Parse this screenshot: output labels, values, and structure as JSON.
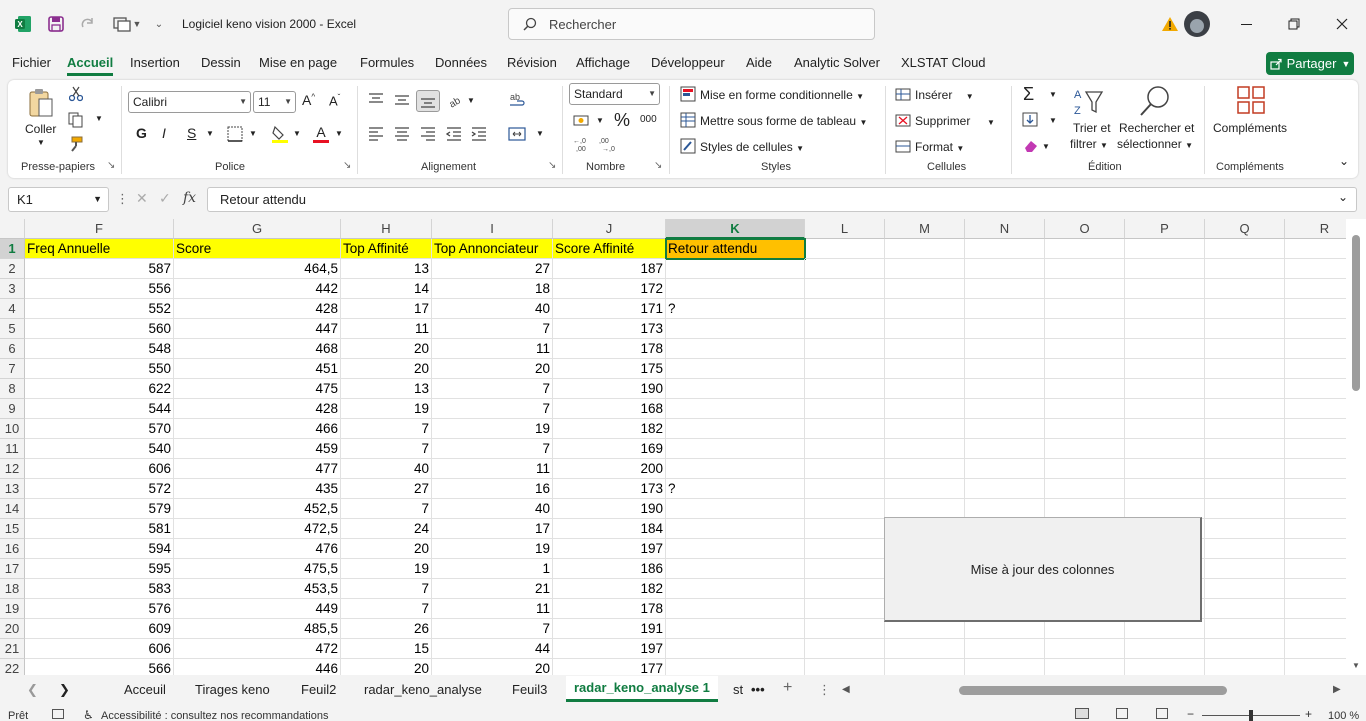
{
  "window": {
    "title": "Logiciel keno vision 2000  -  Excel",
    "search_placeholder": "Rechercher",
    "share_label": "Partager"
  },
  "menu": [
    "Fichier",
    "Accueil",
    "Insertion",
    "Dessin",
    "Mise en page",
    "Formules",
    "Données",
    "Révision",
    "Affichage",
    "Développeur",
    "Aide",
    "Analytic Solver",
    "XLSTAT Cloud"
  ],
  "ribbon": {
    "clipboard": {
      "paste": "Coller",
      "group": "Presse-papiers"
    },
    "font": {
      "name": "Calibri",
      "size": "11",
      "bold": "G",
      "italic": "I",
      "underline": "S",
      "group": "Police"
    },
    "alignment": {
      "group": "Alignement"
    },
    "number": {
      "format": "Standard",
      "group": "Nombre"
    },
    "styles": {
      "conditional": "Mise en forme conditionnelle",
      "table": "Mettre sous forme de tableau",
      "cell_styles": "Styles de cellules",
      "group": "Styles"
    },
    "cells": {
      "insert": "Insérer",
      "delete": "Supprimer",
      "format": "Format",
      "group": "Cellules"
    },
    "editing": {
      "sort1": "Trier et",
      "sort2": "filtrer",
      "find1": "Rechercher et",
      "find2": "sélectionner",
      "group": "Édition"
    },
    "addins": {
      "label": "Compléments",
      "group": "Compléments"
    }
  },
  "formula_bar": {
    "cell_ref": "K1",
    "fx": "fx",
    "content": "Retour attendu"
  },
  "columns": [
    "F",
    "G",
    "H",
    "I",
    "J",
    "K",
    "L",
    "M",
    "N",
    "O",
    "P",
    "Q",
    "R"
  ],
  "headers": {
    "F": "Freq Annuelle",
    "G": "Score",
    "H": "Top Affinité",
    "I": "Top Annonciateur",
    "J": "Score Affinité",
    "K": "Retour attendu"
  },
  "rows": [
    {
      "n": "2",
      "F": "587",
      "G": "464,5",
      "H": "13",
      "I": "27",
      "J": "187",
      "K": ""
    },
    {
      "n": "3",
      "F": "556",
      "G": "442",
      "H": "14",
      "I": "18",
      "J": "172",
      "K": ""
    },
    {
      "n": "4",
      "F": "552",
      "G": "428",
      "H": "17",
      "I": "40",
      "J": "171",
      "K": "?"
    },
    {
      "n": "5",
      "F": "560",
      "G": "447",
      "H": "11",
      "I": "7",
      "J": "173",
      "K": ""
    },
    {
      "n": "6",
      "F": "548",
      "G": "468",
      "H": "20",
      "I": "11",
      "J": "178",
      "K": ""
    },
    {
      "n": "7",
      "F": "550",
      "G": "451",
      "H": "20",
      "I": "20",
      "J": "175",
      "K": ""
    },
    {
      "n": "8",
      "F": "622",
      "G": "475",
      "H": "13",
      "I": "7",
      "J": "190",
      "K": ""
    },
    {
      "n": "9",
      "F": "544",
      "G": "428",
      "H": "19",
      "I": "7",
      "J": "168",
      "K": ""
    },
    {
      "n": "10",
      "F": "570",
      "G": "466",
      "H": "7",
      "I": "19",
      "J": "182",
      "K": ""
    },
    {
      "n": "11",
      "F": "540",
      "G": "459",
      "H": "7",
      "I": "7",
      "J": "169",
      "K": ""
    },
    {
      "n": "12",
      "F": "606",
      "G": "477",
      "H": "40",
      "I": "11",
      "J": "200",
      "K": ""
    },
    {
      "n": "13",
      "F": "572",
      "G": "435",
      "H": "27",
      "I": "16",
      "J": "173",
      "K": "?"
    },
    {
      "n": "14",
      "F": "579",
      "G": "452,5",
      "H": "7",
      "I": "40",
      "J": "190",
      "K": ""
    },
    {
      "n": "15",
      "F": "581",
      "G": "472,5",
      "H": "24",
      "I": "17",
      "J": "184",
      "K": ""
    },
    {
      "n": "16",
      "F": "594",
      "G": "476",
      "H": "20",
      "I": "19",
      "J": "197",
      "K": ""
    },
    {
      "n": "17",
      "F": "595",
      "G": "475,5",
      "H": "19",
      "I": "1",
      "J": "186",
      "K": ""
    },
    {
      "n": "18",
      "F": "583",
      "G": "453,5",
      "H": "7",
      "I": "21",
      "J": "182",
      "K": ""
    },
    {
      "n": "19",
      "F": "576",
      "G": "449",
      "H": "7",
      "I": "11",
      "J": "178",
      "K": ""
    },
    {
      "n": "20",
      "F": "609",
      "G": "485,5",
      "H": "26",
      "I": "7",
      "J": "191",
      "K": ""
    },
    {
      "n": "21",
      "F": "606",
      "G": "472",
      "H": "15",
      "I": "44",
      "J": "197",
      "K": ""
    },
    {
      "n": "22",
      "F": "566",
      "G": "446",
      "H": "20",
      "I": "20",
      "J": "177",
      "K": ""
    }
  ],
  "macro_button": "Mise à jour des colonnes",
  "sheet_tabs": [
    "Acceuil",
    "Tirages keno",
    "Feuil2",
    "radar_keno_analyse",
    "Feuil3",
    "radar_keno_analyse 1",
    "st"
  ],
  "active_tab": "radar_keno_analyse 1",
  "status": {
    "mode": "Prêt",
    "accessibility": "Accessibilité : consultez nos recommandations",
    "zoom": "100 %"
  },
  "colors": {
    "accent": "#107c41",
    "header_fill": "#ffff00",
    "selected_fill": "#ffc000"
  }
}
